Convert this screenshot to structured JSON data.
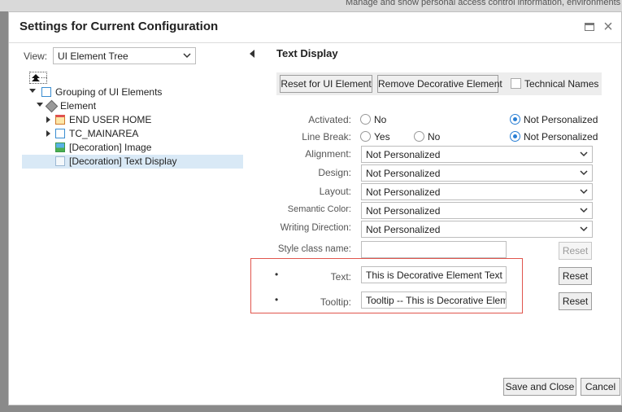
{
  "background": {
    "text": "Manage and show personal access control information, environments"
  },
  "dialog": {
    "title": "Settings for Current Configuration",
    "maximize_icon": "window-maximize-icon",
    "close_icon": "close-icon"
  },
  "left": {
    "view_label": "View:",
    "view_value": "UI Element Tree",
    "tree": {
      "up_label": "...",
      "items": [
        {
          "label": "Grouping of UI Elements"
        },
        {
          "label": "Element"
        },
        {
          "label": "END USER HOME"
        },
        {
          "label": "TC_MAINAREA"
        },
        {
          "label": "[Decoration] Image"
        },
        {
          "label": "[Decoration] Text Display"
        }
      ]
    }
  },
  "right": {
    "title": "Text Display",
    "toolbar": {
      "reset_ui": "Reset for UI Element",
      "remove_decorative": "Remove Decorative Element",
      "technical_names": "Technical Names"
    },
    "fields": {
      "activated": {
        "label": "Activated:",
        "opt_no": "No",
        "opt_np": "Not Personalized"
      },
      "line_break": {
        "label": "Line Break:",
        "opt_yes": "Yes",
        "opt_no": "No",
        "opt_np": "Not Personalized"
      },
      "alignment": {
        "label": "Alignment:",
        "value": "Not Personalized"
      },
      "design": {
        "label": "Design:",
        "value": "Not Personalized"
      },
      "layout": {
        "label": "Layout:",
        "value": "Not Personalized"
      },
      "semantic_color": {
        "label": "Semantic Color:",
        "value": "Not Personalized"
      },
      "writing_direction": {
        "label": "Writing Direction:",
        "value": "Not Personalized"
      },
      "style_class": {
        "label": "Style class name:",
        "value": "",
        "reset": "Reset"
      },
      "text": {
        "marker": "•",
        "label": "Text:",
        "value": "This is Decorative Element Text",
        "reset": "Reset"
      },
      "tooltip": {
        "marker": "•",
        "label": "Tooltip:",
        "value": "Tooltip -- This is Decorative Elemer",
        "reset": "Reset"
      }
    }
  },
  "footer": {
    "save_close": "Save and Close",
    "cancel": "Cancel"
  },
  "colors": {
    "accent": "#2a7fd4",
    "highlight": "#e0554d",
    "selected_row": "#d9e9f6"
  }
}
